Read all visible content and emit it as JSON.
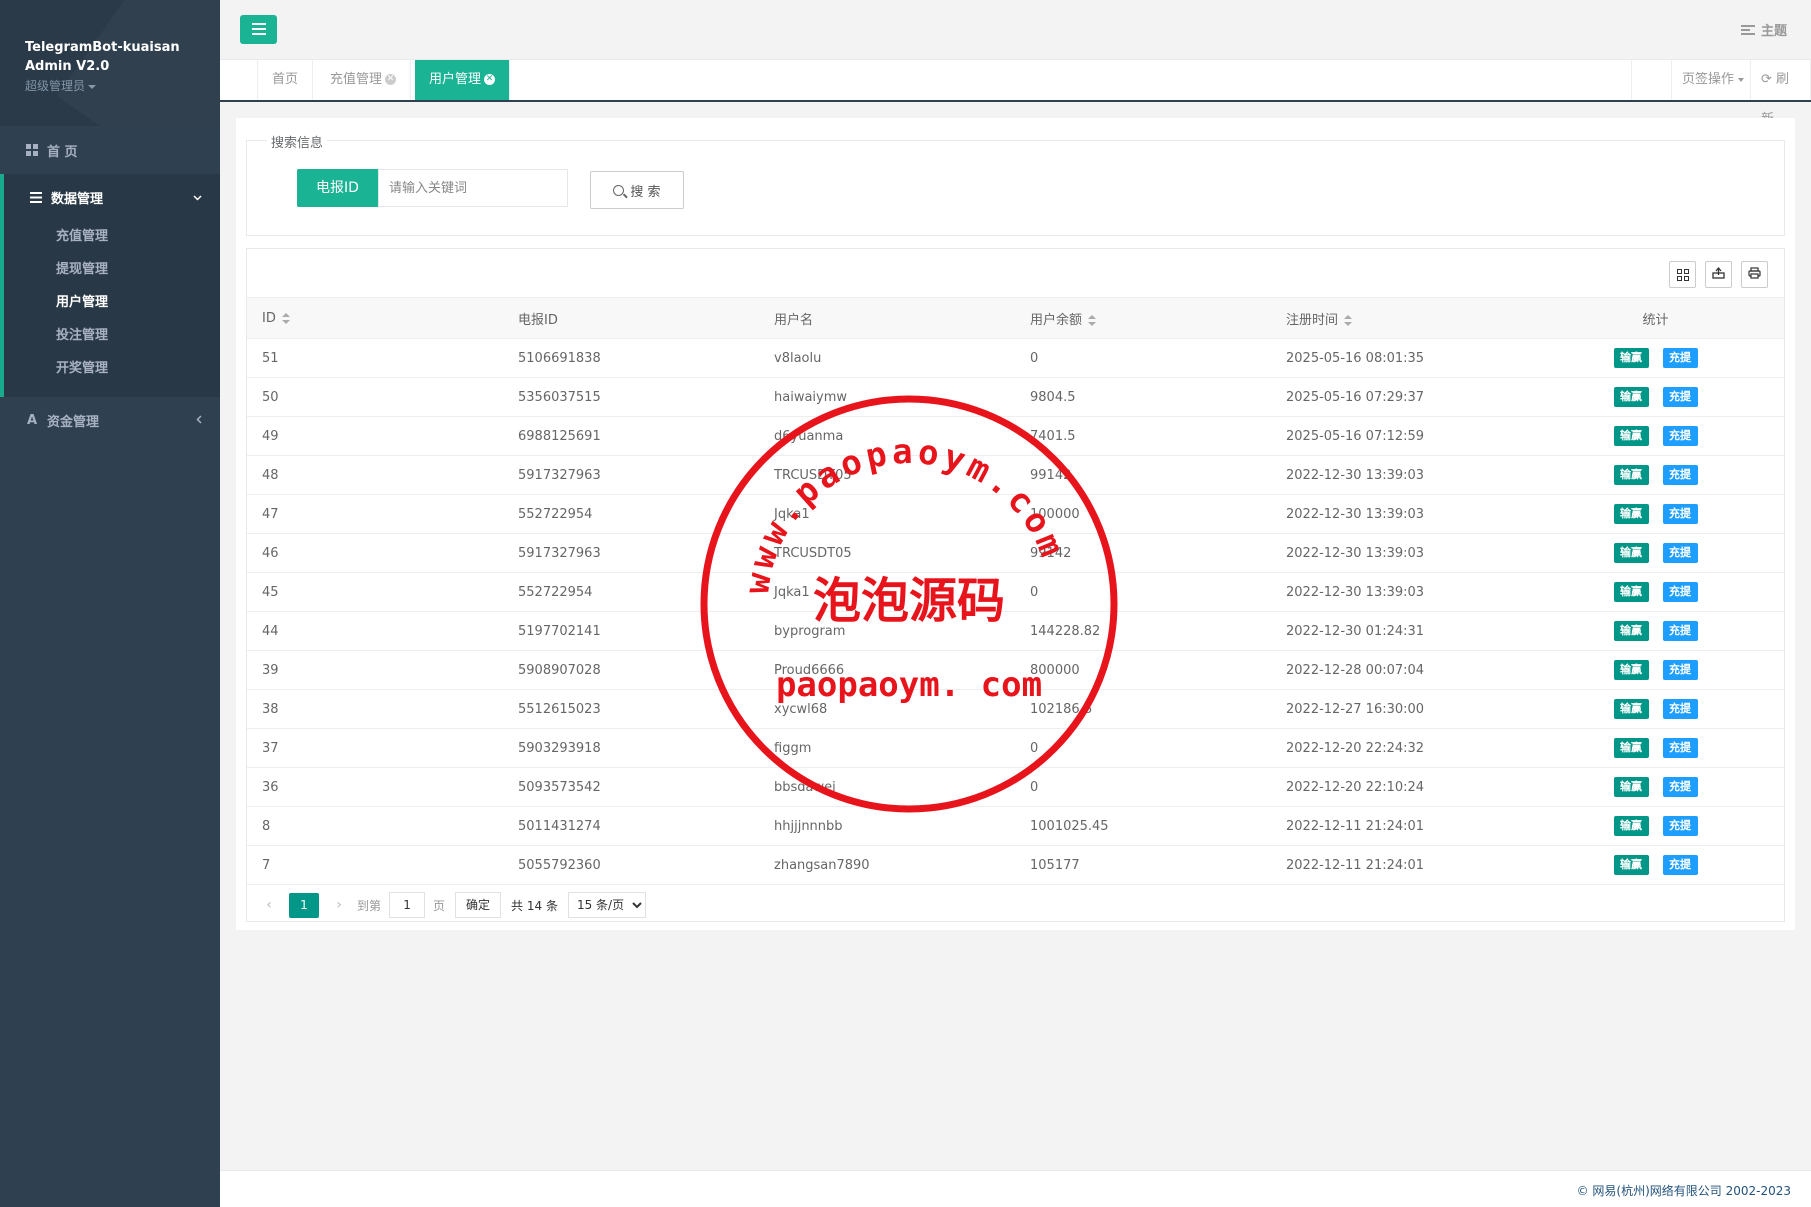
{
  "brand": {
    "title_line1": "TelegramBot-kuaisan",
    "title_line2": "Admin V2.0",
    "role": "超级管理员"
  },
  "sidebar": {
    "home": "首 页",
    "data_group": "数据管理",
    "data_items": [
      "充值管理",
      "提现管理",
      "用户管理",
      "投注管理",
      "开奖管理"
    ],
    "fund_group": "资金管理"
  },
  "topbar": {
    "theme": "主题"
  },
  "tabs": {
    "items": [
      "首页",
      "充值管理",
      "用户管理"
    ],
    "page_ops": "页签操作",
    "refresh": "刷新"
  },
  "search": {
    "legend": "搜索信息",
    "field_label": "电报ID",
    "placeholder": "请输入关键词",
    "button": "搜 索"
  },
  "table": {
    "headers": [
      "ID",
      "电报ID",
      "用户名",
      "用户余额",
      "注册时间",
      "统计"
    ],
    "action_win": "输赢",
    "action_charge": "充提",
    "rows": [
      [
        "51",
        "5106691838",
        "v8laolu",
        "0",
        "2025-05-16 08:01:35"
      ],
      [
        "50",
        "5356037515",
        "haiwaiymw",
        "9804.5",
        "2025-05-16 07:29:37"
      ],
      [
        "49",
        "6988125691",
        "d6yuanma",
        "7401.5",
        "2025-05-16 07:12:59"
      ],
      [
        "48",
        "5917327963",
        "TRCUSDT05",
        "99142",
        "2022-12-30 13:39:03"
      ],
      [
        "47",
        "552722954",
        "Jqka1",
        "100000",
        "2022-12-30 13:39:03"
      ],
      [
        "46",
        "5917327963",
        "TRCUSDT05",
        "99142",
        "2022-12-30 13:39:03"
      ],
      [
        "45",
        "552722954",
        "Jqka1",
        "0",
        "2022-12-30 13:39:03"
      ],
      [
        "44",
        "5197702141",
        "byprogram",
        "144228.82",
        "2022-12-30 01:24:31"
      ],
      [
        "39",
        "5908907028",
        "Proud6666",
        "800000",
        "2022-12-28 00:07:04"
      ],
      [
        "38",
        "5512615023",
        "xycwl68",
        "102186.6",
        "2022-12-27 16:30:00"
      ],
      [
        "37",
        "5903293918",
        "figgm",
        "0",
        "2022-12-20 22:24:32"
      ],
      [
        "36",
        "5093573542",
        "bbsdawei",
        "0",
        "2022-12-20 22:10:24"
      ],
      [
        "8",
        "5011431274",
        "hhjjjnnnbb",
        "1001025.45",
        "2022-12-11 21:24:01"
      ],
      [
        "7",
        "5055792360",
        "zhangsan7890",
        "105177",
        "2022-12-11 21:24:01"
      ]
    ]
  },
  "pager": {
    "current": "1",
    "goto_label": "到第",
    "goto_value": "1",
    "page_unit": "页",
    "confirm": "确定",
    "total": "共 14 条",
    "per_page": "15 条/页"
  },
  "footer": {
    "copyright": "© 网易(杭州)网络有限公司 2002-2023"
  },
  "watermark": {
    "arc_text": "www.paopaoym.com",
    "center_text": "泡泡源码",
    "bottom_text": "paopaoym. com",
    "color": "#e8141c"
  },
  "colors": {
    "accent": "#1ab394",
    "sidebar": "#2f4050",
    "btn_teal": "#009688",
    "btn_blue": "#1e9fff"
  }
}
